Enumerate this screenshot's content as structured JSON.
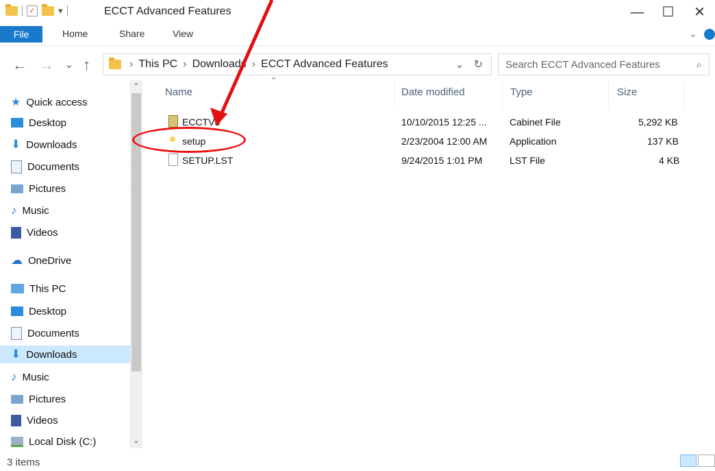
{
  "window": {
    "title": "ECCT Advanced Features",
    "minimize": "—",
    "maximize": "☐",
    "close": "✕"
  },
  "ribbon": {
    "tabs": [
      "File",
      "Home",
      "Share",
      "View"
    ]
  },
  "address": {
    "back": "←",
    "forward": "→",
    "recent": "⌄",
    "up": "↑",
    "crumbs": [
      "This PC",
      "Downloads",
      "ECCT Advanced Features"
    ],
    "dropdown": "⌄",
    "refresh": "↻",
    "search_placeholder": "Search ECCT Advanced Features",
    "search_icon": "⌕"
  },
  "sidebar": {
    "items": [
      {
        "label": "Quick access",
        "icon": "quick-access-icon",
        "pinned": false
      },
      {
        "label": "Desktop",
        "icon": "desktop-icon",
        "pinned": true
      },
      {
        "label": "Downloads",
        "icon": "downloads-icon",
        "pinned": true
      },
      {
        "label": "Documents",
        "icon": "documents-icon",
        "pinned": true
      },
      {
        "label": "Pictures",
        "icon": "pictures-icon",
        "pinned": true
      },
      {
        "label": "Music",
        "icon": "music-icon",
        "pinned": false
      },
      {
        "label": "Videos",
        "icon": "videos-icon",
        "pinned": false
      },
      {
        "label": "OneDrive",
        "icon": "onedrive-icon",
        "pinned": false
      },
      {
        "label": "This PC",
        "icon": "this-pc-icon",
        "pinned": false
      },
      {
        "label": "Desktop",
        "icon": "desktop-icon",
        "pinned": false
      },
      {
        "label": "Documents",
        "icon": "documents-icon",
        "pinned": false
      },
      {
        "label": "Downloads",
        "icon": "downloads-icon",
        "pinned": false,
        "selected": true
      },
      {
        "label": "Music",
        "icon": "music-icon",
        "pinned": false
      },
      {
        "label": "Pictures",
        "icon": "pictures-icon",
        "pinned": false
      },
      {
        "label": "Videos",
        "icon": "videos-icon",
        "pinned": false
      },
      {
        "label": "Local Disk (C:)",
        "icon": "local-disk-icon",
        "pinned": false
      }
    ]
  },
  "files": {
    "headers": [
      "Name",
      "Date modified",
      "Type",
      "Size"
    ],
    "rows": [
      {
        "name": "ECCTV3",
        "date": "10/10/2015 12:25 ...",
        "type": "Cabinet File",
        "size": "5,292 KB",
        "icon": "cabinet-file-icon"
      },
      {
        "name": "setup",
        "date": "2/23/2004 12:00 AM",
        "type": "Application",
        "size": "137 KB",
        "icon": "application-icon"
      },
      {
        "name": "SETUP.LST",
        "date": "9/24/2015 1:01 PM",
        "type": "LST File",
        "size": "4 KB",
        "icon": "lst-file-icon"
      }
    ]
  },
  "status": {
    "items": "3 items"
  },
  "colors": {
    "accent": "#1979ca",
    "selection": "#cce8ff",
    "annotation": "#e11111"
  }
}
